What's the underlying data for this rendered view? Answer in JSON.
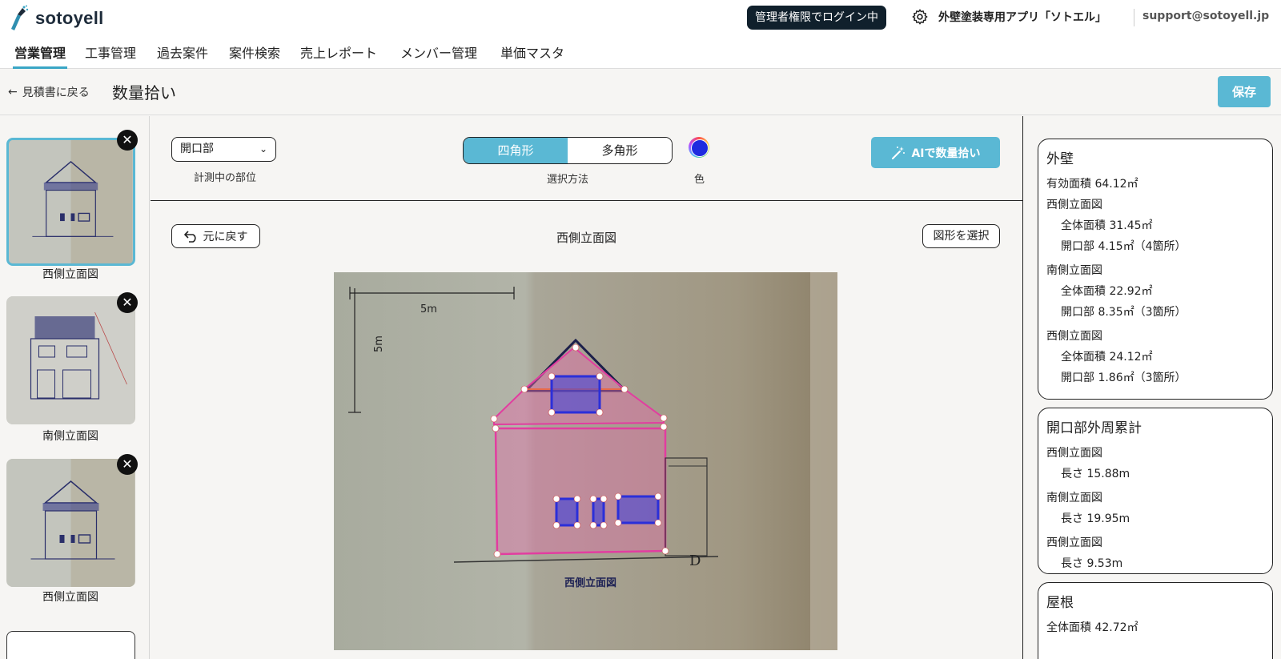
{
  "header": {
    "logo_text": "sotoyell",
    "admin_badge": "管理者権限でログイン中",
    "app_name": "外壁塗装専用アプリ「ソトエル」",
    "support_email": "support@sotoyell.jp",
    "gear_icon": "gear-icon"
  },
  "nav": {
    "tabs": [
      {
        "label": "営業管理",
        "active": true
      },
      {
        "label": "工事管理",
        "active": false
      },
      {
        "label": "過去案件",
        "active": false
      },
      {
        "label": "案件検索",
        "active": false
      },
      {
        "label": "売上レポート",
        "active": false
      },
      {
        "label": "メンバー管理",
        "active": false
      },
      {
        "label": "単価マスタ",
        "active": false
      }
    ]
  },
  "subbar": {
    "back_label": "見積書に戻る",
    "title": "数量拾い",
    "save_label": "保存"
  },
  "thumbnails": [
    {
      "label": "西側立面図",
      "selected": true
    },
    {
      "label": "南側立面図",
      "selected": false
    },
    {
      "label": "西側立面図",
      "selected": false
    }
  ],
  "toolbar": {
    "part_select_value": "開口部",
    "part_caption": "計測中の部位",
    "method_options": [
      "四角形",
      "多角形"
    ],
    "method_selected": "四角形",
    "method_caption": "選択方法",
    "color_caption": "色",
    "color_value": "#1f2bdf",
    "ai_button": "AIで数量拾い"
  },
  "canvas": {
    "undo_label": "元に戻す",
    "title": "西側立面図",
    "select_shape_label": "図形を選択",
    "drawing_scale_h": "5m",
    "drawing_scale_v": "5m",
    "drawing_caption": "西側立面図",
    "drawing_mark": "D"
  },
  "summary": {
    "wall": {
      "title": "外壁",
      "effective_area": "有効面積 64.12㎡",
      "sections": [
        {
          "name": "西側立面図",
          "total": "全体面積 31.45㎡",
          "openings": "開口部 4.15㎡（4箇所）"
        },
        {
          "name": "南側立面図",
          "total": "全体面積 22.92㎡",
          "openings": "開口部 8.35㎡（3箇所）"
        },
        {
          "name": "西側立面図",
          "total": "全体面積 24.12㎡",
          "openings": "開口部 1.86㎡（3箇所）"
        }
      ]
    },
    "perimeter": {
      "title": "開口部外周累計",
      "sections": [
        {
          "name": "西側立面図",
          "length": "長さ 15.88m"
        },
        {
          "name": "南側立面図",
          "length": "長さ 19.95m"
        },
        {
          "name": "西側立面図",
          "length": "長さ 9.53m"
        }
      ]
    },
    "roof": {
      "title": "屋根",
      "total": "全体面積 42.72㎡"
    }
  }
}
